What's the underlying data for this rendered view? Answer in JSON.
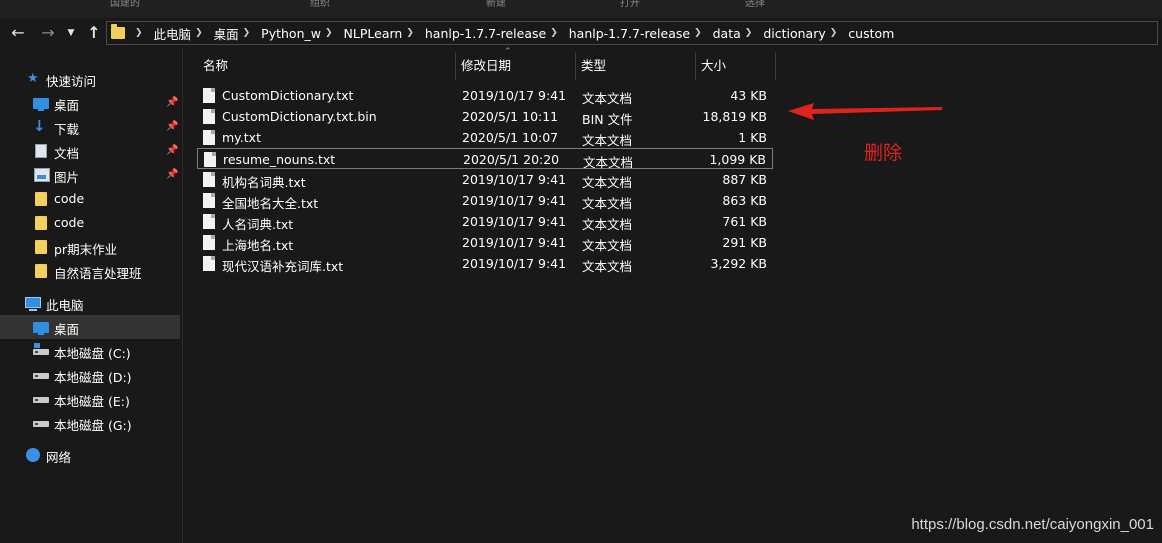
{
  "ribbon": {
    "items": [
      "国建的",
      "组织",
      "新建",
      "打开",
      "选择"
    ]
  },
  "nav": {
    "back_icon": "arrow-left-icon",
    "forward_icon": "arrow-right-icon",
    "recent_icon": "chevron-down-icon",
    "up_icon": "arrow-up-icon"
  },
  "breadcrumb": [
    "此电脑",
    "桌面",
    "Python_w",
    "NLPLearn",
    "hanlp-1.7.7-release",
    "hanlp-1.7.7-release",
    "data",
    "dictionary",
    "custom"
  ],
  "sidebar": {
    "items": [
      {
        "label": "快速访问",
        "icon": "star-icon"
      },
      {
        "label": "桌面",
        "icon": "desktop-icon",
        "pinned": true
      },
      {
        "label": "下载",
        "icon": "download-icon",
        "pinned": true
      },
      {
        "label": "文档",
        "icon": "document-icon",
        "pinned": true
      },
      {
        "label": "图片",
        "icon": "picture-icon",
        "pinned": true
      },
      {
        "label": "code",
        "icon": "folder-icon"
      },
      {
        "label": "code",
        "icon": "folder-icon"
      },
      {
        "label": "pr期末作业",
        "icon": "folder-icon"
      },
      {
        "label": "自然语言处理班",
        "icon": "folder-icon"
      },
      {
        "label": "此电脑",
        "icon": "computer-icon"
      },
      {
        "label": "桌面",
        "icon": "desktop-icon",
        "selected": true
      },
      {
        "label": "本地磁盘 (C:)",
        "icon": "drive-icon"
      },
      {
        "label": "本地磁盘 (D:)",
        "icon": "drive-icon"
      },
      {
        "label": "本地磁盘 (E:)",
        "icon": "drive-icon"
      },
      {
        "label": "本地磁盘 (G:)",
        "icon": "drive-icon"
      },
      {
        "label": "网络",
        "icon": "network-icon"
      }
    ]
  },
  "columns": {
    "name": "名称",
    "date": "修改日期",
    "type": "类型",
    "size": "大小"
  },
  "files": [
    {
      "name": "CustomDictionary.txt",
      "date": "2019/10/17 9:41",
      "type": "文本文档",
      "size": "43 KB"
    },
    {
      "name": "CustomDictionary.txt.bin",
      "date": "2020/5/1 10:11",
      "type": "BIN 文件",
      "size": "18,819 KB"
    },
    {
      "name": "my.txt",
      "date": "2020/5/1 10:07",
      "type": "文本文档",
      "size": "1 KB"
    },
    {
      "name": "resume_nouns.txt",
      "date": "2020/5/1 20:20",
      "type": "文本文档",
      "size": "1,099 KB"
    },
    {
      "name": "机构名词典.txt",
      "date": "2019/10/17 9:41",
      "type": "文本文档",
      "size": "887 KB"
    },
    {
      "name": "全国地名大全.txt",
      "date": "2019/10/17 9:41",
      "type": "文本文档",
      "size": "863 KB"
    },
    {
      "name": "人名词典.txt",
      "date": "2019/10/17 9:41",
      "type": "文本文档",
      "size": "761 KB"
    },
    {
      "name": "上海地名.txt",
      "date": "2019/10/17 9:41",
      "type": "文本文档",
      "size": "291 KB"
    },
    {
      "name": "现代汉语补充词库.txt",
      "date": "2019/10/17 9:41",
      "type": "文本文档",
      "size": "3,292 KB"
    }
  ],
  "annotation": {
    "label": "删除",
    "color": "#e0221d"
  },
  "watermark": "https://blog.csdn.net/caiyongxin_001"
}
